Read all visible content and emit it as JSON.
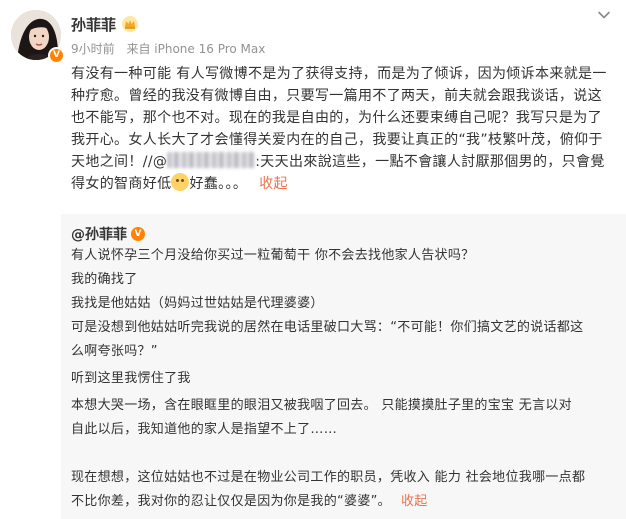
{
  "user": {
    "name": "孙菲菲",
    "time": "9小时前",
    "source": "来自 iPhone 16 Pro Max"
  },
  "post": {
    "text_before_mention": "有没有一种可能 有人写微博不是为了获得支持，而是为了倾诉，因为倾诉本来就是一种疗愈。曾经的我没有微博自由，只要写一篇用不了两天，前夫就会跟我谈话，说这也不能写，那个也不对。现在的我是自由的，为什么还要束缚自己呢？我写只是为了我开心。女人长大了才会懂得关爱内在的自己，我要让真正的“我”枝繁叶茂，俯仰于天地之间！//@",
    "text_mid": ":天天出來說這些，一點不會讓人討厭那個男的，只會覺得女的智商好低",
    "text_end": "好蠢。。。",
    "collapse_label": "收起"
  },
  "repost": {
    "author": "@孙菲菲",
    "lines": [
      "有人说怀孕三个月没给你买过一粒葡萄干  你不会去找他家人告状吗？",
      "我的确找了",
      "我找是他姑姑（妈妈过世姑姑是代理婆婆）",
      "可是没想到他姑姑听完我说的居然在电话里破口大骂：“不可能！你们搞文艺的说话都这",
      "么啊夸张吗？”",
      "听到这里我愣住了我",
      "本想大哭一场，含在眼眶里的眼泪又被我咽了回去。 只能摸摸肚子里的宝宝  无言以对",
      "自此以后，我知道他的家人是指望不上了……",
      "",
      "现在想想，这位姑姑也不过是在物业公司工作的职员，凭收入 能力 社会地位我哪一点都",
      "不比你差，我对你的忍让仅仅是因为你是我的“婆婆”。"
    ],
    "collapse_label": "收起"
  },
  "icons": {
    "more": "chevron-down-icon",
    "crown": "crown-badge-icon",
    "verified": "verified-v-icon",
    "emoji": "facepalm-emoji-icon"
  },
  "colors": {
    "link": "#eb7350",
    "meta": "#939393",
    "repost_bg": "#f7f7f7",
    "verified": "#ff8200",
    "crown": "#f5a623"
  }
}
